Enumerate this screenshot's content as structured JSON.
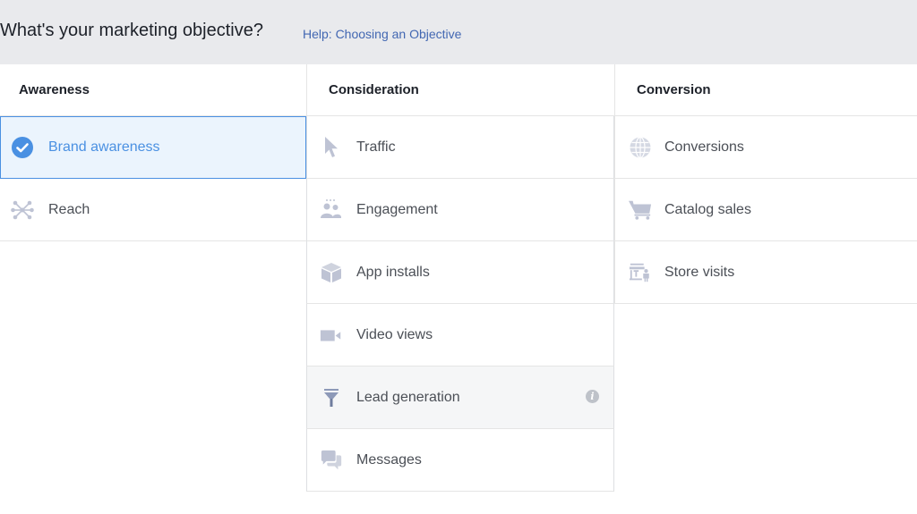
{
  "header": {
    "title": "What's your marketing objective?",
    "help_link": "Help: Choosing an Objective"
  },
  "colors": {
    "accent": "#4a90e2",
    "selected_bg": "#ebf4fd",
    "icon": "#bec3d4",
    "header_bg": "#e9eaed",
    "link": "#4267b2"
  },
  "columns": [
    {
      "heading": "Awareness",
      "items": [
        {
          "label": "Brand awareness",
          "icon": "check-circle-icon",
          "selected": true
        },
        {
          "label": "Reach",
          "icon": "reach-network-icon"
        }
      ]
    },
    {
      "heading": "Consideration",
      "items": [
        {
          "label": "Traffic",
          "icon": "cursor-icon"
        },
        {
          "label": "Engagement",
          "icon": "people-icon"
        },
        {
          "label": "App installs",
          "icon": "box-icon"
        },
        {
          "label": "Video views",
          "icon": "video-camera-icon"
        },
        {
          "label": "Lead generation",
          "icon": "funnel-icon",
          "info": "i"
        },
        {
          "label": "Messages",
          "icon": "chat-bubbles-icon"
        }
      ]
    },
    {
      "heading": "Conversion",
      "items": [
        {
          "label": "Conversions",
          "icon": "globe-icon"
        },
        {
          "label": "Catalog sales",
          "icon": "shopping-cart-icon"
        },
        {
          "label": "Store visits",
          "icon": "store-visit-icon"
        }
      ]
    }
  ]
}
